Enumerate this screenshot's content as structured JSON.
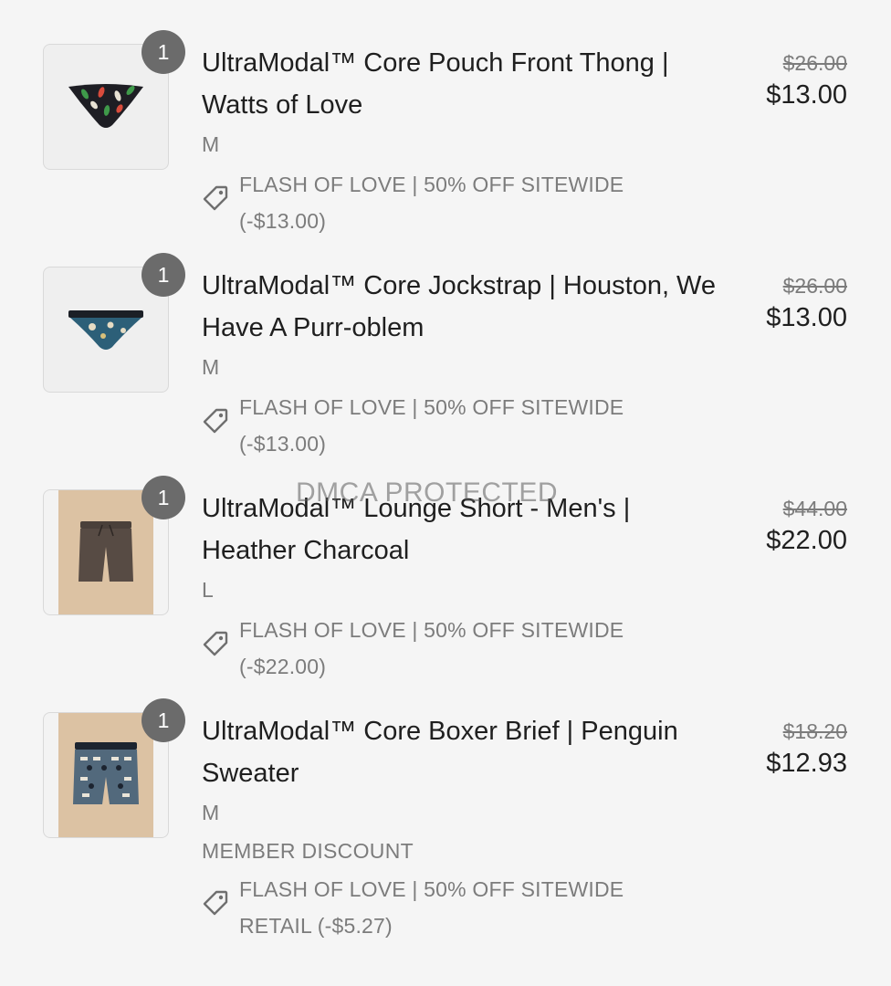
{
  "watermark": "DMCA PROTECTED",
  "items": [
    {
      "quantity": "1",
      "title": "UltraModal™ Core Pouch Front Thong | Watts of Love",
      "variant": "M",
      "original_price": "$26.00",
      "sale_price": "$13.00",
      "discount": "FLASH OF LOVE | 50% OFF SITEWIDE (-$13.00)"
    },
    {
      "quantity": "1",
      "title": "UltraModal™ Core Jockstrap | Houston, We Have A Purr-oblem",
      "variant": "M",
      "original_price": "$26.00",
      "sale_price": "$13.00",
      "discount": "FLASH OF LOVE | 50% OFF SITEWIDE (-$13.00)"
    },
    {
      "quantity": "1",
      "title": "UltraModal™ Lounge Short - Men's | Heather Charcoal",
      "variant": "L",
      "original_price": "$44.00",
      "sale_price": "$22.00",
      "discount": "FLASH OF LOVE | 50% OFF SITEWIDE (-$22.00)"
    },
    {
      "quantity": "1",
      "title": "UltraModal™ Core Boxer Brief | Penguin Sweater",
      "variant": "M",
      "member_label": "MEMBER DISCOUNT",
      "original_price": "$18.20",
      "sale_price": "$12.93",
      "discount": "FLASH OF LOVE | 50% OFF SITEWIDE RETAIL (-$5.27)"
    }
  ],
  "icons": {
    "tag": "price-tag-icon"
  },
  "colors": {
    "badge": "#6b6b6b",
    "muted_text": "#7c7c7c",
    "primary_text": "#1f1f1f",
    "background": "#f5f5f5"
  }
}
